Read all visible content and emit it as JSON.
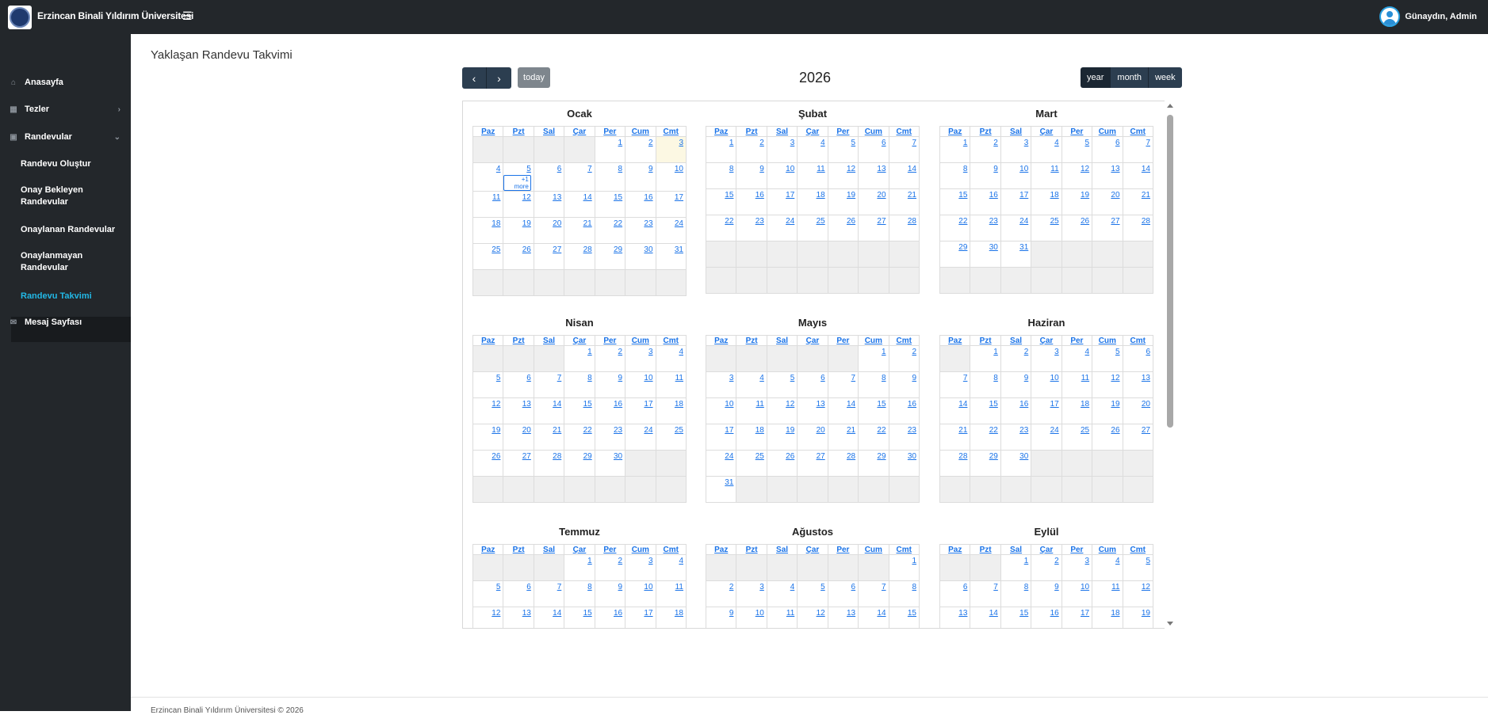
{
  "app": {
    "brand": "Erzincan Binali Yıldırım Üniversitesi",
    "menu_icon": "hamburger-icon",
    "greeting": "Günaydın, Admin"
  },
  "sidebar": {
    "items": [
      {
        "label": "Anasayfa",
        "icon": "home-icon"
      },
      {
        "label": "Tezler",
        "icon": "book-icon"
      },
      {
        "label": "Randevular",
        "icon": "calendar-icon"
      },
      {
        "label": "Mesaj Sayfası",
        "icon": "mail-icon"
      }
    ],
    "sub_items": [
      "Randevu Oluştur",
      "Onay Bekleyen Randevular",
      "Onaylanan Randevular",
      "Onaylanmayan Randevular",
      "Randevu Takvimi"
    ]
  },
  "page": {
    "title": "Yaklaşan Randevu Takvimi",
    "today_label": "today",
    "year": "2026",
    "views": [
      "year",
      "month",
      "week"
    ],
    "active_view": "year"
  },
  "calendar": {
    "weekdays": [
      "Paz",
      "Pzt",
      "Sal",
      "Çar",
      "Per",
      "Cum",
      "Cmt"
    ],
    "more_label": "+1 more",
    "months": [
      {
        "name": "Ocak",
        "start": 4,
        "days": 31,
        "today": 3,
        "event_day": 5
      },
      {
        "name": "Şubat",
        "start": 0,
        "days": 28
      },
      {
        "name": "Mart",
        "start": 0,
        "days": 31
      },
      {
        "name": "Nisan",
        "start": 3,
        "days": 30
      },
      {
        "name": "Mayıs",
        "start": 5,
        "days": 31
      },
      {
        "name": "Haziran",
        "start": 1,
        "days": 30
      },
      {
        "name": "Temmuz",
        "start": 3,
        "days": 31
      },
      {
        "name": "Ağustos",
        "start": 6,
        "days": 31
      },
      {
        "name": "Eylül",
        "start": 2,
        "days": 30
      }
    ]
  },
  "footer": {
    "text": "Erzincan Binali Yıldırım Üniversitesi © 2026"
  }
}
